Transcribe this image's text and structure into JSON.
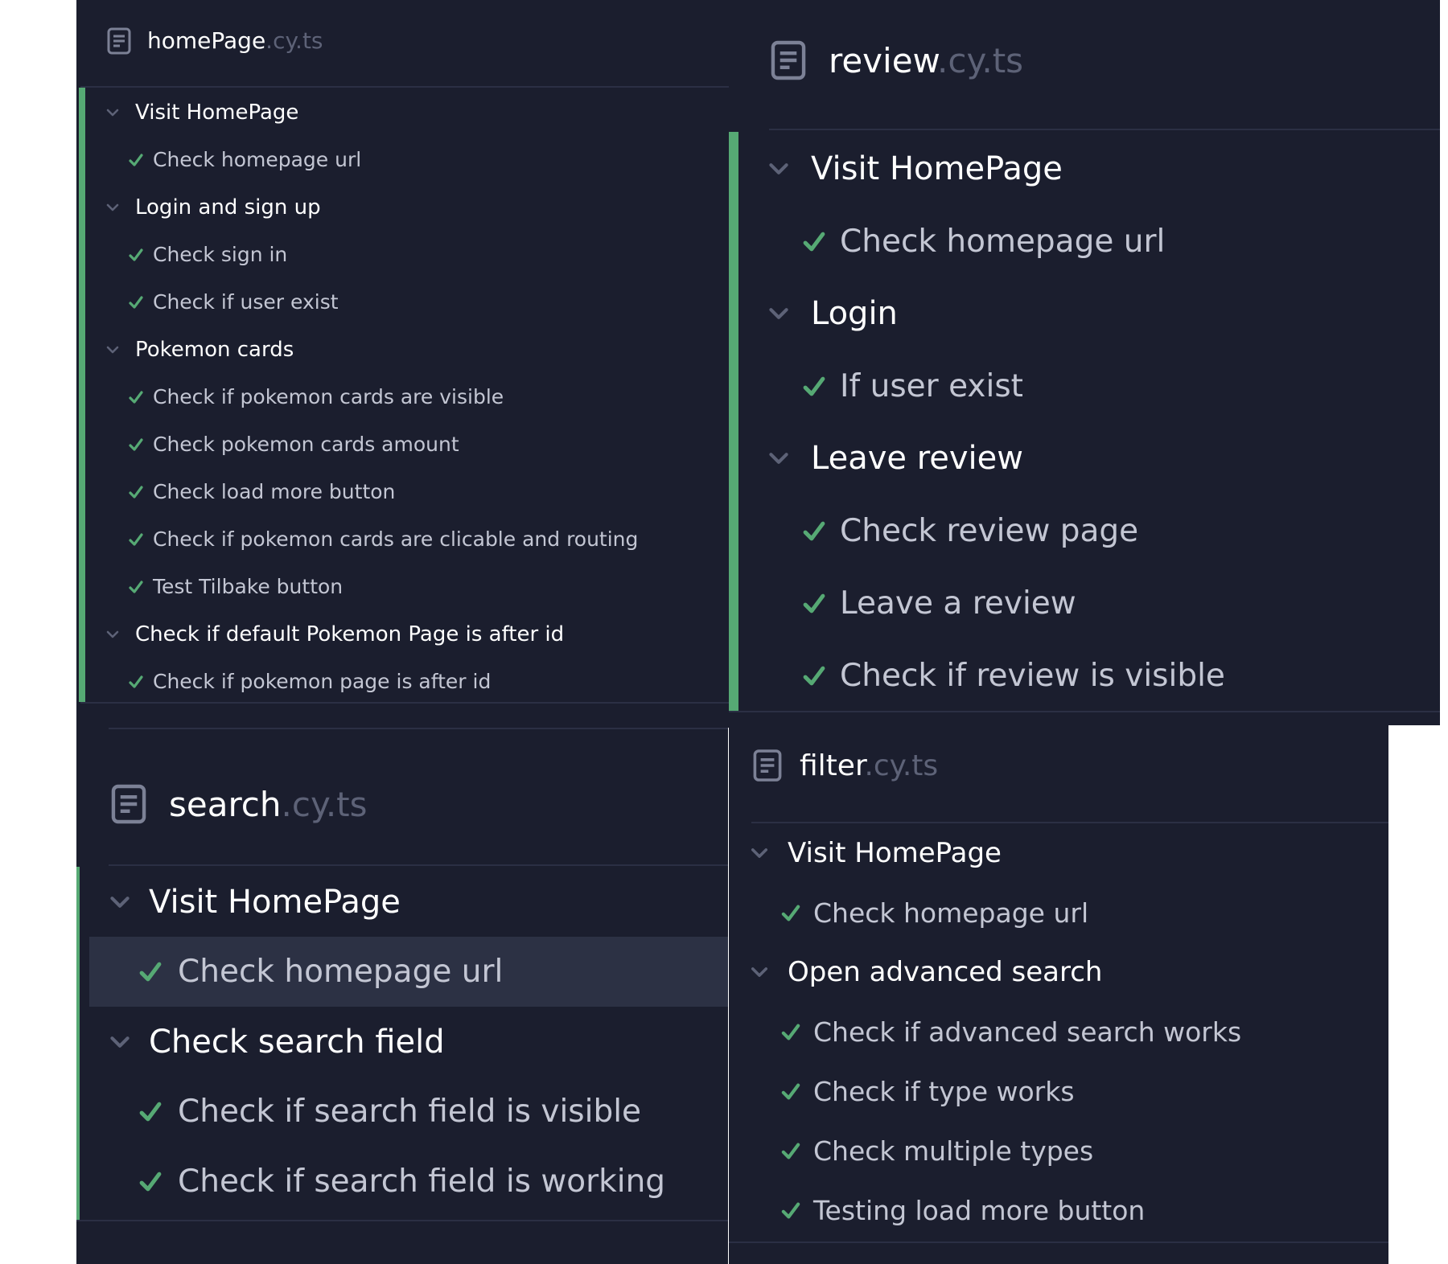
{
  "colors": {
    "panel_bg": "#1b1e2e",
    "pass_green": "#56a974",
    "suite_text": "#ffffff",
    "test_text": "#c3c6d3",
    "extension_text": "#5d6277",
    "highlight_row": "#2c3144"
  },
  "icons": {
    "file": "file-document-icon",
    "collapse": "chevron-down-icon",
    "pass": "checkmark-icon"
  },
  "panels": {
    "homepage": {
      "file_name": "homePage",
      "file_ext": ".cy.ts",
      "suites": [
        {
          "label": "Visit HomePage",
          "tests": [
            "Check homepage url"
          ]
        },
        {
          "label": "Login and sign up",
          "tests": [
            "Check sign in",
            "Check if user exist"
          ]
        },
        {
          "label": "Pokemon cards",
          "tests": [
            "Check if pokemon cards are visible",
            "Check pokemon cards amount",
            "Check load more button",
            "Check if pokemon cards are clicable and routing",
            "Test Tilbake button"
          ]
        },
        {
          "label": "Check if default Pokemon Page is after id",
          "tests": [
            "Check if pokemon page is after id"
          ]
        }
      ]
    },
    "review": {
      "file_name": "review",
      "file_ext": ".cy.ts",
      "suites": [
        {
          "label": "Visit HomePage",
          "tests": [
            "Check homepage url"
          ]
        },
        {
          "label": "Login",
          "tests": [
            "If user exist"
          ]
        },
        {
          "label": "Leave review",
          "tests": [
            "Check review page",
            "Leave a review",
            "Check if review is visible"
          ]
        }
      ]
    },
    "search": {
      "file_name": "search",
      "file_ext": ".cy.ts",
      "suites": [
        {
          "label": "Visit HomePage",
          "tests": [
            "Check homepage url"
          ]
        },
        {
          "label": "Check search field",
          "tests": [
            "Check if search field is visible",
            "Check if search field is working"
          ]
        }
      ]
    },
    "filter": {
      "file_name": "filter",
      "file_ext": ".cy.ts",
      "suites": [
        {
          "label": "Visit HomePage",
          "tests": [
            "Check homepage url"
          ]
        },
        {
          "label": "Open advanced search",
          "tests": [
            "Check if advanced search works",
            "Check if type works",
            "Check multiple types",
            "Testing load more button"
          ]
        }
      ]
    }
  }
}
